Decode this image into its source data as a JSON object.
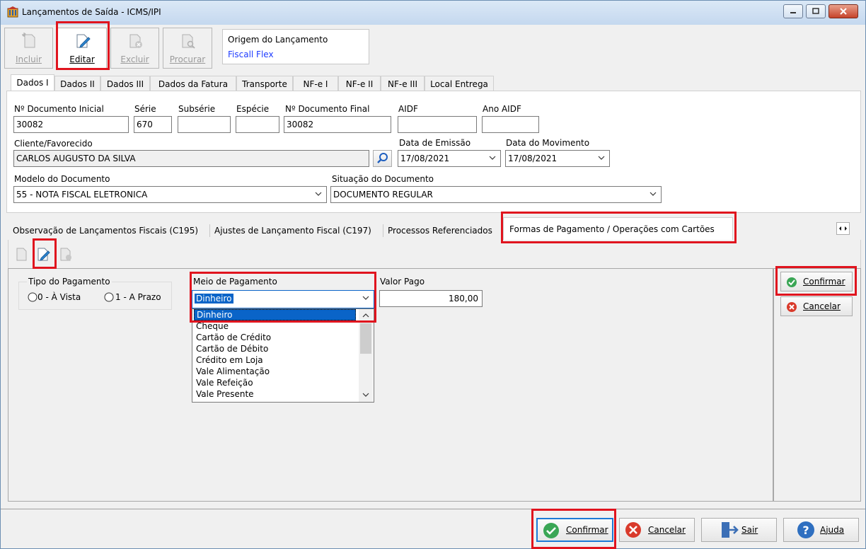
{
  "window": {
    "title": "Lançamentos de Saída - ICMS/IPI"
  },
  "toolbar": {
    "incluir": "Incluir",
    "editar": "Editar",
    "excluir": "Excluir",
    "procurar": "Procurar"
  },
  "origin": {
    "label": "Origem do Lançamento",
    "value": "Fiscall Flex"
  },
  "tabs": [
    "Dados I",
    "Dados II",
    "Dados III",
    "Dados da Fatura",
    "Transporte",
    "NF-e I",
    "NF-e II",
    "NF-e III",
    "Local Entrega"
  ],
  "form": {
    "doc_inicial": {
      "label": "Nº Documento Inicial",
      "value": "30082"
    },
    "serie": {
      "label": "Série",
      "value": "670"
    },
    "subserie": {
      "label": "Subsérie",
      "value": ""
    },
    "especie": {
      "label": "Espécie",
      "value": ""
    },
    "doc_final": {
      "label": "Nº Documento Final",
      "value": "30082"
    },
    "aidf": {
      "label": "AIDF",
      "value": ""
    },
    "ano_aidf": {
      "label": "Ano AIDF",
      "value": ""
    },
    "cliente": {
      "label": "Cliente/Favorecido",
      "value": "CARLOS AUGUSTO DA SILVA"
    },
    "data_emissao": {
      "label": "Data de Emissão",
      "value": "17/08/2021"
    },
    "data_movimento": {
      "label": "Data do Movimento",
      "value": "17/08/2021"
    },
    "modelo": {
      "label": "Modelo do Documento",
      "value": "55 - NOTA FISCAL ELETRONICA"
    },
    "situacao": {
      "label": "Situação do Documento",
      "value": "DOCUMENTO REGULAR"
    }
  },
  "bottom_tabs": [
    "Observação de Lançamentos Fiscais (C195)",
    "Ajustes de Lançamento Fiscal (C197)",
    "Processos Referenciados",
    "Formas de Pagamento / Operações com Cartões"
  ],
  "payment": {
    "tipo_label": "Tipo do Pagamento",
    "tipo_options": [
      "0 - À Vista",
      "1 - A Prazo"
    ],
    "meio_label": "Meio de Pagamento",
    "meio_value": "Dinheiro",
    "meio_options": [
      "Dinheiro",
      "Cheque",
      "Cartão de Crédito",
      "Cartão de Débito",
      "Crédito em Loja",
      "Vale Alimentação",
      "Vale Refeição",
      "Vale Presente"
    ],
    "valor_label": "Valor Pago",
    "valor_value": "180,00",
    "confirm": "Confirmar",
    "cancel": "Cancelar"
  },
  "footer": {
    "confirm": "Confirmar",
    "cancel": "Cancelar",
    "exit": "Sair",
    "help": "Ajuda"
  }
}
